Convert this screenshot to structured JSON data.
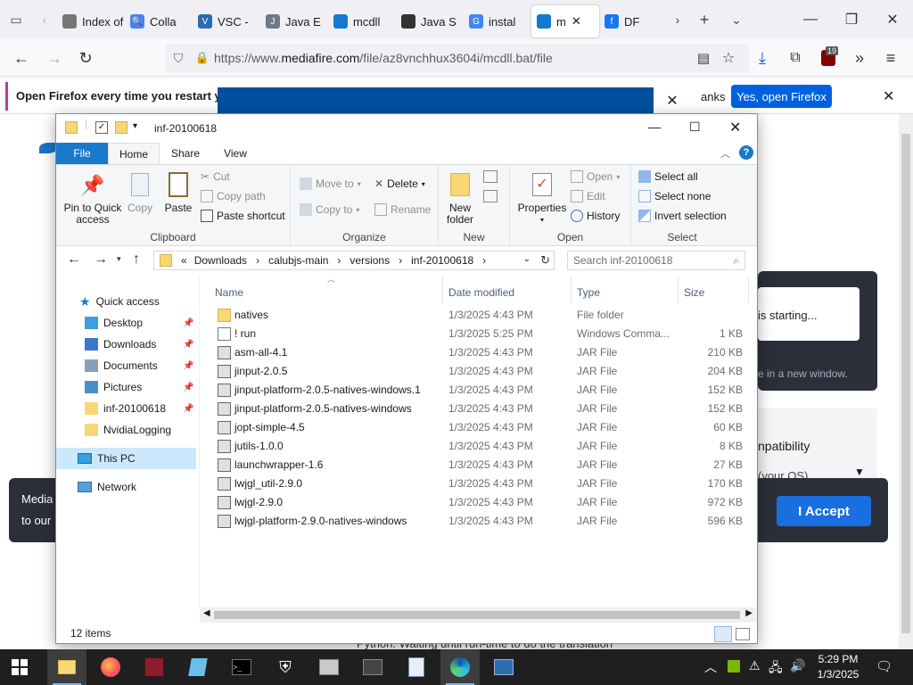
{
  "browser": {
    "tabs": [
      {
        "label": "Index of /",
        "color": "#777777",
        "glyph": ""
      },
      {
        "label": "Colla",
        "color": "#4a80f5",
        "glyph": "🔍"
      },
      {
        "label": "VSC -",
        "color": "#2b6cb0",
        "glyph": "V"
      },
      {
        "label": "Java E",
        "color": "#6a7c8c",
        "glyph": "J"
      },
      {
        "label": "mcdll",
        "color": "#1679d0",
        "glyph": ""
      },
      {
        "label": "Java S",
        "color": "#333333",
        "glyph": ""
      },
      {
        "label": "instal",
        "color": "#4285f4",
        "glyph": "G"
      },
      {
        "label": "m",
        "color": "#1679d0",
        "glyph": ""
      },
      {
        "label": "DF",
        "color": "#1877f2",
        "glyph": "f"
      }
    ],
    "url_prefix": "https://www.",
    "url_host": "mediafire.com",
    "url_path": "/file/az8vnchhux3604i/mcdll.bat/file",
    "extension_badge": "19"
  },
  "notification": {
    "text": "Open Firefox every time you restart your",
    "thanks_label": "anks",
    "open_label": "Yes, open Firefox"
  },
  "mediafire": {
    "starting_text": "is starting...",
    "new_window_text": "e in a new window.",
    "compat_text": "npatibility",
    "os_text": "(your OS)",
    "cookie_text_1": "Media",
    "cookie_text_2": "to our",
    "accept_label": "I Accept",
    "footer_text": "Python. Waiting until run-time to do the translation"
  },
  "explorer": {
    "title": "inf-20100618",
    "ribbon_tabs": [
      "File",
      "Home",
      "Share",
      "View"
    ],
    "clipboard": {
      "pin_label_1": "Pin to Quick",
      "pin_label_2": "access",
      "copy": "Copy",
      "paste": "Paste",
      "cut": "Cut",
      "copy_path": "Copy path",
      "paste_shortcut": "Paste shortcut",
      "group": "Clipboard"
    },
    "organize": {
      "move_to": "Move to",
      "copy_to": "Copy to",
      "delete": "Delete",
      "rename": "Rename",
      "group": "Organize"
    },
    "new": {
      "new_folder_1": "New",
      "new_folder_2": "folder",
      "group": "New"
    },
    "open": {
      "properties": "Properties",
      "open": "Open",
      "edit": "Edit",
      "history": "History",
      "group": "Open"
    },
    "select": {
      "select_all": "Select all",
      "select_none": "Select none",
      "invert": "Invert selection",
      "group": "Select"
    },
    "breadcrumb": [
      "«",
      "Downloads",
      "calubjs-main",
      "versions",
      "inf-20100618"
    ],
    "search_placeholder": "Search inf-20100618",
    "nav": {
      "quick_access": "Quick access",
      "items": [
        "Desktop",
        "Downloads",
        "Documents",
        "Pictures",
        "inf-20100618",
        "NvidiaLogging"
      ],
      "this_pc": "This PC",
      "network": "Network"
    },
    "columns": [
      "Name",
      "Date modified",
      "Type",
      "Size"
    ],
    "files": [
      {
        "name": "natives",
        "date": "1/3/2025 4:43 PM",
        "type": "File folder",
        "size": "",
        "kind": "folder"
      },
      {
        "name": "! run",
        "date": "1/3/2025 5:25 PM",
        "type": "Windows Comma...",
        "size": "1 KB",
        "kind": "bat"
      },
      {
        "name": "asm-all-4.1",
        "date": "1/3/2025 4:43 PM",
        "type": "JAR File",
        "size": "210 KB",
        "kind": "jar"
      },
      {
        "name": "jinput-2.0.5",
        "date": "1/3/2025 4:43 PM",
        "type": "JAR File",
        "size": "204 KB",
        "kind": "jar"
      },
      {
        "name": "jinput-platform-2.0.5-natives-windows.1",
        "date": "1/3/2025 4:43 PM",
        "type": "JAR File",
        "size": "152 KB",
        "kind": "jar"
      },
      {
        "name": "jinput-platform-2.0.5-natives-windows",
        "date": "1/3/2025 4:43 PM",
        "type": "JAR File",
        "size": "152 KB",
        "kind": "jar"
      },
      {
        "name": "jopt-simple-4.5",
        "date": "1/3/2025 4:43 PM",
        "type": "JAR File",
        "size": "60 KB",
        "kind": "jar"
      },
      {
        "name": "jutils-1.0.0",
        "date": "1/3/2025 4:43 PM",
        "type": "JAR File",
        "size": "8 KB",
        "kind": "jar"
      },
      {
        "name": "launchwrapper-1.6",
        "date": "1/3/2025 4:43 PM",
        "type": "JAR File",
        "size": "27 KB",
        "kind": "jar"
      },
      {
        "name": "lwjgl_util-2.9.0",
        "date": "1/3/2025 4:43 PM",
        "type": "JAR File",
        "size": "170 KB",
        "kind": "jar"
      },
      {
        "name": "lwjgl-2.9.0",
        "date": "1/3/2025 4:43 PM",
        "type": "JAR File",
        "size": "972 KB",
        "kind": "jar"
      },
      {
        "name": "lwjgl-platform-2.9.0-natives-windows",
        "date": "1/3/2025 4:43 PM",
        "type": "JAR File",
        "size": "596 KB",
        "kind": "jar"
      }
    ],
    "status": "12 items"
  },
  "taskbar": {
    "time": "5:29 PM",
    "date": "1/3/2025"
  },
  "colors": {
    "accent": "#0061e0",
    "explorer_file_tab": "#1979ca",
    "taskbar": "#1f1f1f"
  }
}
